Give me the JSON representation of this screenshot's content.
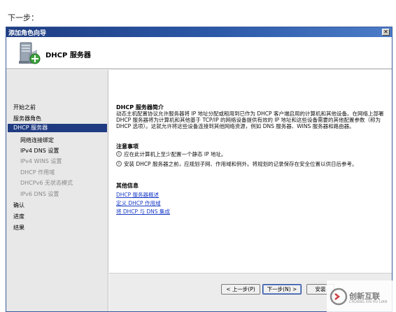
{
  "caption": "下一步：",
  "window": {
    "title": "添加角色向导",
    "close_glyph": "✕"
  },
  "header": {
    "title": "DHCP 服务器",
    "icon": "dhcp-server-icon"
  },
  "sidebar": {
    "items": [
      {
        "label": "开始之前",
        "state": "normal"
      },
      {
        "label": "服务器角色",
        "state": "normal"
      },
      {
        "label": "DHCP 服务器",
        "state": "active"
      },
      {
        "label": "网络连接绑定",
        "state": "sub"
      },
      {
        "label": "IPv4 DNS 设置",
        "state": "sub"
      },
      {
        "label": "IPv4 WINS 设置",
        "state": "sub-dim"
      },
      {
        "label": "DHCP 作用域",
        "state": "sub-dim"
      },
      {
        "label": "DHCPv6 无状态模式",
        "state": "sub-dim"
      },
      {
        "label": "IPv6 DNS 设置",
        "state": "sub-dim"
      },
      {
        "label": "确认",
        "state": "normal"
      },
      {
        "label": "进度",
        "state": "normal"
      },
      {
        "label": "结果",
        "state": "normal"
      }
    ]
  },
  "content": {
    "intro_heading": "DHCP 服务器简介",
    "intro_text": "动态主机配置协议允许服务器将 IP 地址分配或租用到已作为 DHCP 客户端启用的计算机和其他设备。在网络上部署 DHCP 服务器将为计算机和其他基于 TCP/IP 的网络设备提供有效的 IP 地址和这些设备需要的其他配置参数（称为 DHCP 选项）。这就允许将这些设备连接到其他网络资源，例如 DNS 服务器、WINS 服务器和路由器。",
    "notes_heading": "注意事项",
    "notes": [
      "应在此计算机上至少配置一个静态 IP 地址。",
      "安装 DHCP 服务器之前，应规划子网、作用域和例外。将规划的记录保存在安全位置以供日后参考。"
    ],
    "info_icon_glyph": "i",
    "more_heading": "其他信息",
    "links": [
      "DHCP 服务器概述",
      "定义 DHCP 作用域",
      "将 DHCP 与 DNS 集成"
    ]
  },
  "footer": {
    "back_label": "< 上一步(P)",
    "next_label": "下一步(N) >",
    "install_label": "安装"
  },
  "watermark": {
    "text": "创新互联",
    "sub": "CHUANG XIN HU LIAN"
  },
  "colors": {
    "titlebar": "#1e3c82",
    "active_item": "#1f3b82",
    "link": "#1a3cc8"
  }
}
